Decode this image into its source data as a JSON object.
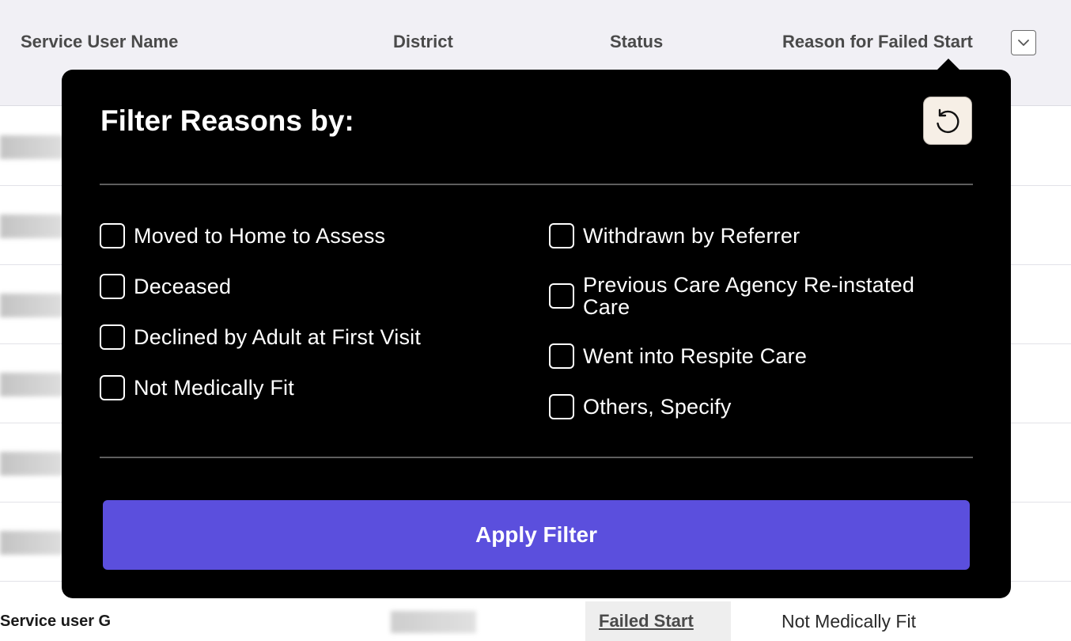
{
  "table": {
    "headers": {
      "service_user_name": "Service User Name",
      "district": "District",
      "status": "Status",
      "reason": "Reason for Failed Start"
    },
    "sort_icon": "chevron-down-icon",
    "visible_row": {
      "name": "Service user G",
      "status": "Failed Start",
      "reason": "Not Medically Fit"
    }
  },
  "filter_popover": {
    "title": "Filter Reasons by:",
    "reset_icon": "reset-icon",
    "options_left": [
      {
        "label": "Moved to Home to Assess",
        "checked": false
      },
      {
        "label": "Deceased",
        "checked": false
      },
      {
        "label": "Declined by Adult at First Visit",
        "checked": false
      },
      {
        "label": "Not Medically Fit",
        "checked": false
      }
    ],
    "options_right": [
      {
        "label": "Withdrawn by Referrer",
        "checked": false
      },
      {
        "label": "Previous Care Agency Re-instated Care",
        "checked": false
      },
      {
        "label": "Went into Respite Care",
        "checked": false
      },
      {
        "label": "Others, Specify",
        "checked": false
      }
    ],
    "apply_label": "Apply Filter",
    "colors": {
      "popover_bg": "#000000",
      "apply_button": "#5b4fdd",
      "reset_button_bg": "#f6efe6"
    }
  }
}
